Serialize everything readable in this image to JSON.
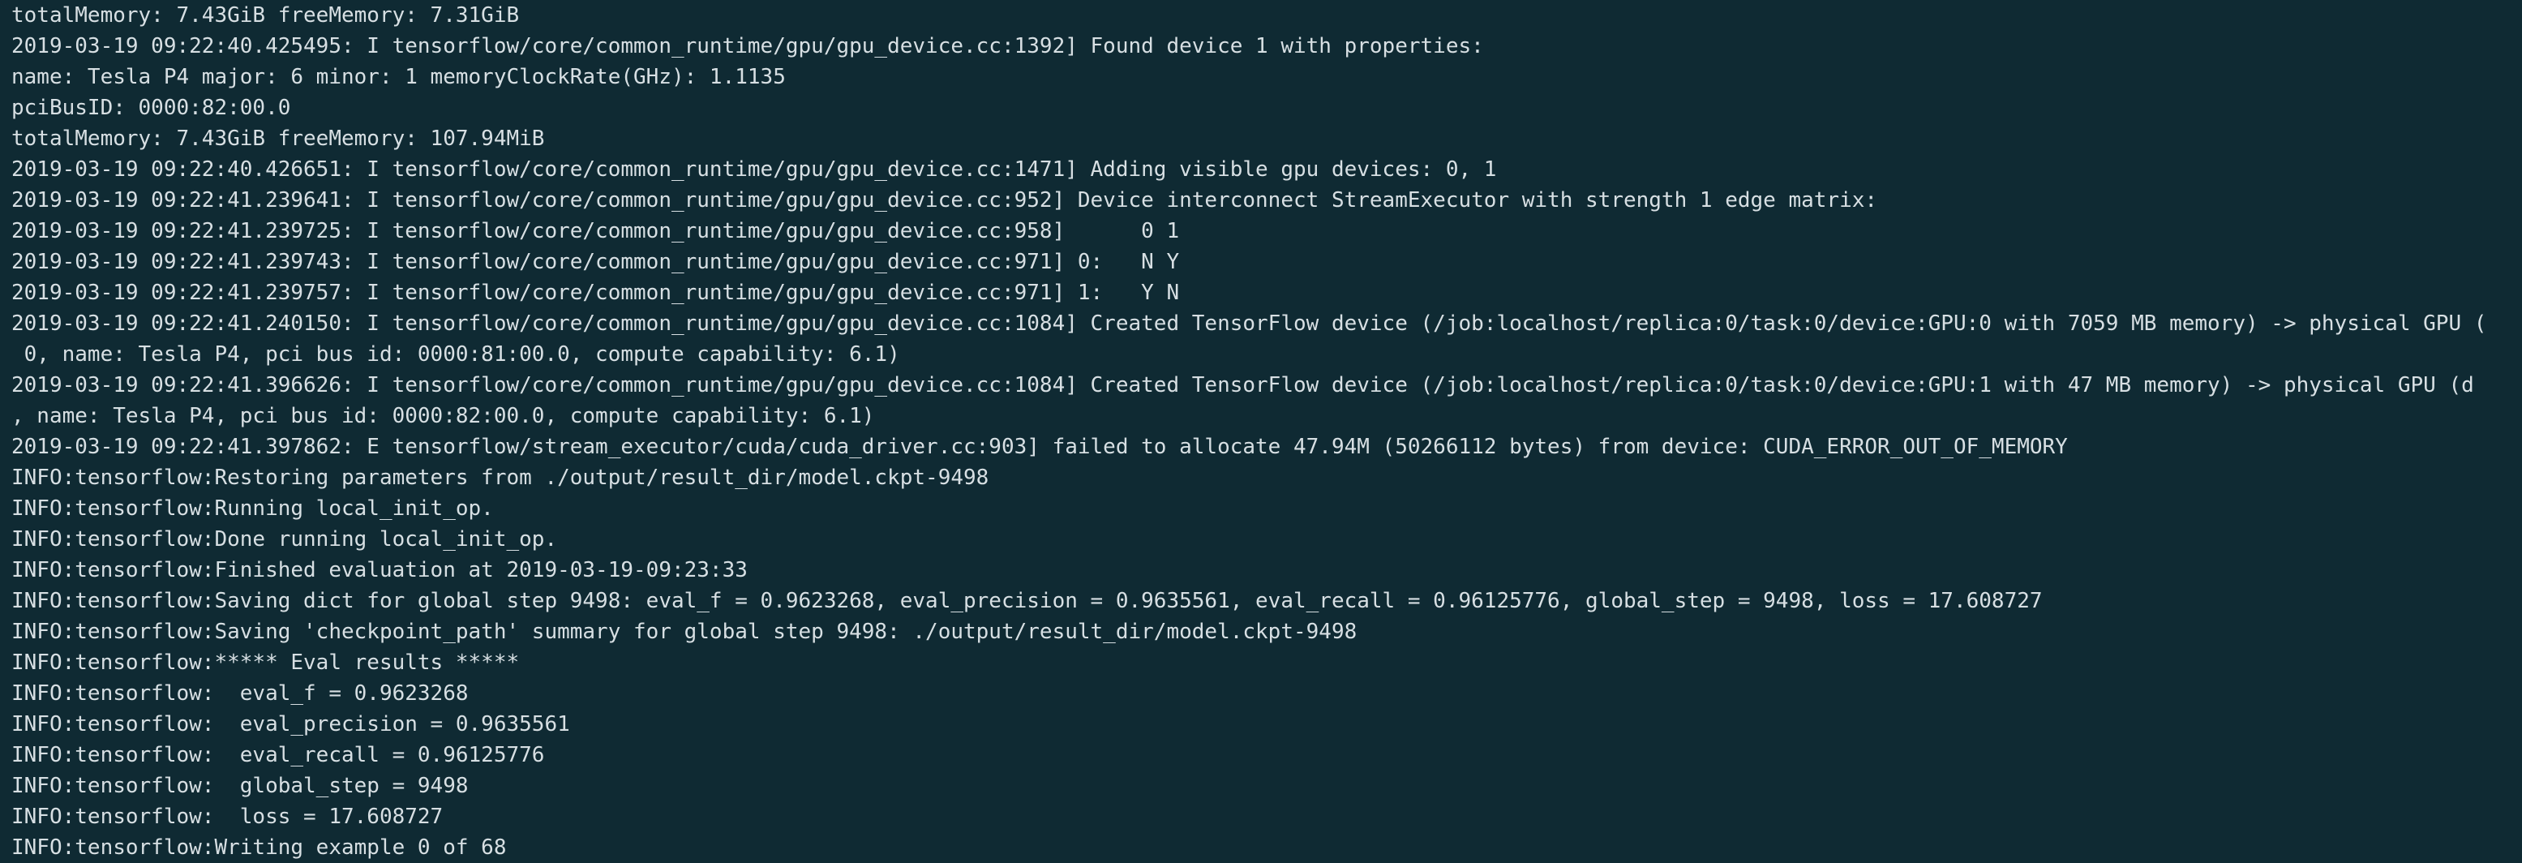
{
  "terminal": {
    "lines": [
      "totalMemory: 7.43GiB freeMemory: 7.31GiB",
      "2019-03-19 09:22:40.425495: I tensorflow/core/common_runtime/gpu/gpu_device.cc:1392] Found device 1 with properties:",
      "name: Tesla P4 major: 6 minor: 1 memoryClockRate(GHz): 1.1135",
      "pciBusID: 0000:82:00.0",
      "totalMemory: 7.43GiB freeMemory: 107.94MiB",
      "2019-03-19 09:22:40.426651: I tensorflow/core/common_runtime/gpu/gpu_device.cc:1471] Adding visible gpu devices: 0, 1",
      "2019-03-19 09:22:41.239641: I tensorflow/core/common_runtime/gpu/gpu_device.cc:952] Device interconnect StreamExecutor with strength 1 edge matrix:",
      "2019-03-19 09:22:41.239725: I tensorflow/core/common_runtime/gpu/gpu_device.cc:958]      0 1",
      "2019-03-19 09:22:41.239743: I tensorflow/core/common_runtime/gpu/gpu_device.cc:971] 0:   N Y",
      "2019-03-19 09:22:41.239757: I tensorflow/core/common_runtime/gpu/gpu_device.cc:971] 1:   Y N",
      "2019-03-19 09:22:41.240150: I tensorflow/core/common_runtime/gpu/gpu_device.cc:1084] Created TensorFlow device (/job:localhost/replica:0/task:0/device:GPU:0 with 7059 MB memory) -> physical GPU (",
      " 0, name: Tesla P4, pci bus id: 0000:81:00.0, compute capability: 6.1)",
      "2019-03-19 09:22:41.396626: I tensorflow/core/common_runtime/gpu/gpu_device.cc:1084] Created TensorFlow device (/job:localhost/replica:0/task:0/device:GPU:1 with 47 MB memory) -> physical GPU (d",
      ", name: Tesla P4, pci bus id: 0000:82:00.0, compute capability: 6.1)",
      "2019-03-19 09:22:41.397862: E tensorflow/stream_executor/cuda/cuda_driver.cc:903] failed to allocate 47.94M (50266112 bytes) from device: CUDA_ERROR_OUT_OF_MEMORY",
      "INFO:tensorflow:Restoring parameters from ./output/result_dir/model.ckpt-9498",
      "INFO:tensorflow:Running local_init_op.",
      "INFO:tensorflow:Done running local_init_op.",
      "INFO:tensorflow:Finished evaluation at 2019-03-19-09:23:33",
      "INFO:tensorflow:Saving dict for global step 9498: eval_f = 0.9623268, eval_precision = 0.9635561, eval_recall = 0.96125776, global_step = 9498, loss = 17.608727",
      "INFO:tensorflow:Saving 'checkpoint_path' summary for global step 9498: ./output/result_dir/model.ckpt-9498",
      "INFO:tensorflow:***** Eval results *****",
      "INFO:tensorflow:  eval_f = 0.9623268",
      "INFO:tensorflow:  eval_precision = 0.9635561",
      "INFO:tensorflow:  eval_recall = 0.96125776",
      "INFO:tensorflow:  global_step = 9498",
      "INFO:tensorflow:  loss = 17.608727",
      "INFO:tensorflow:Writing example 0 of 68"
    ],
    "colors": {
      "background": "#0f2a33",
      "foreground": "#d7dfe3"
    }
  }
}
